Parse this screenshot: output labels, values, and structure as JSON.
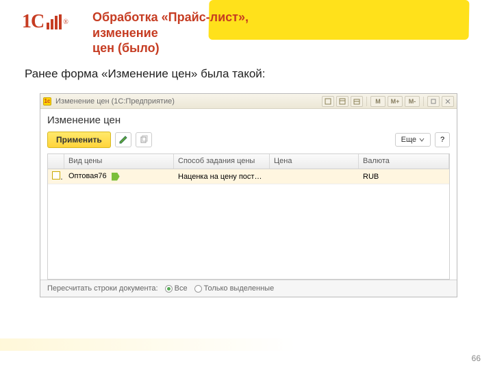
{
  "slide": {
    "title_line1": "Обработка «Прайс-лист», изменение",
    "title_line2": "цен (было)",
    "lead": "Ранее форма «Изменение цен» была такой:",
    "page_number": "66",
    "logo_text": "1C"
  },
  "window": {
    "title": "Изменение цен  (1С:Предприятие)",
    "titlebuttons": {
      "m": "M",
      "mplus": "M+",
      "mminus": "M-"
    },
    "form_title": "Изменение цен",
    "apply_label": "Применить",
    "more_label": "Еще",
    "help_label": "?",
    "columns": {
      "price_type": "Вид цены",
      "method": "Способ задания цены",
      "price": "Цена",
      "currency": "Валюта"
    },
    "rows": [
      {
        "price_type": "Оптовая76",
        "method": "Наценка на цену пост…",
        "price": "",
        "currency": "RUB"
      }
    ],
    "footer": {
      "label": "Пересчитать строки документа:",
      "opt_all": "Все",
      "opt_selected": "Только выделенные"
    }
  }
}
